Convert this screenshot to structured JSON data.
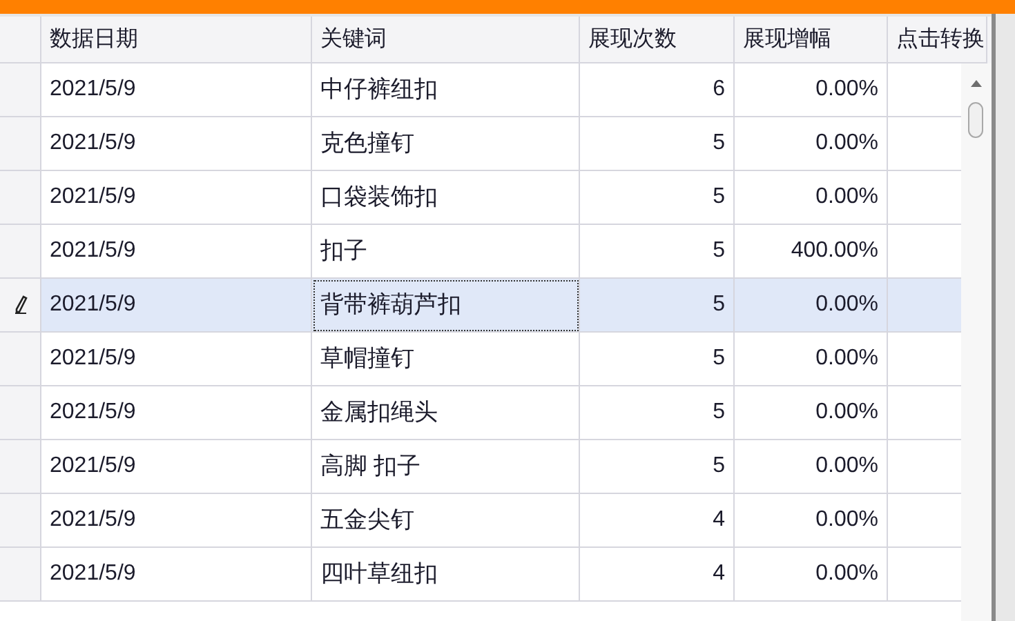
{
  "table": {
    "columns": [
      "数据日期",
      "关键词",
      "展现次数",
      "展现增幅",
      "点击转换"
    ],
    "rows": [
      {
        "date": "2021/5/9",
        "keyword": "中仔裤纽扣",
        "impressions": "6",
        "growth": "0.00%",
        "selected": false
      },
      {
        "date": "2021/5/9",
        "keyword": "克色撞钉",
        "impressions": "5",
        "growth": "0.00%",
        "selected": false
      },
      {
        "date": "2021/5/9",
        "keyword": "口袋装饰扣",
        "impressions": "5",
        "growth": "0.00%",
        "selected": false
      },
      {
        "date": "2021/5/9",
        "keyword": "扣子",
        "impressions": "5",
        "growth": "400.00%",
        "selected": false
      },
      {
        "date": "2021/5/9",
        "keyword": "背带裤葫芦扣",
        "impressions": "5",
        "growth": "0.00%",
        "selected": true
      },
      {
        "date": "2021/5/9",
        "keyword": "草帽撞钉",
        "impressions": "5",
        "growth": "0.00%",
        "selected": false
      },
      {
        "date": "2021/5/9",
        "keyword": "金属扣绳头",
        "impressions": "5",
        "growth": "0.00%",
        "selected": false
      },
      {
        "date": "2021/5/9",
        "keyword": "高脚 扣子",
        "impressions": "5",
        "growth": "0.00%",
        "selected": false
      },
      {
        "date": "2021/5/9",
        "keyword": "五金尖钉",
        "impressions": "4",
        "growth": "0.00%",
        "selected": false
      },
      {
        "date": "2021/5/9",
        "keyword": "四叶草纽扣",
        "impressions": "4",
        "growth": "0.00%",
        "selected": false
      }
    ]
  }
}
